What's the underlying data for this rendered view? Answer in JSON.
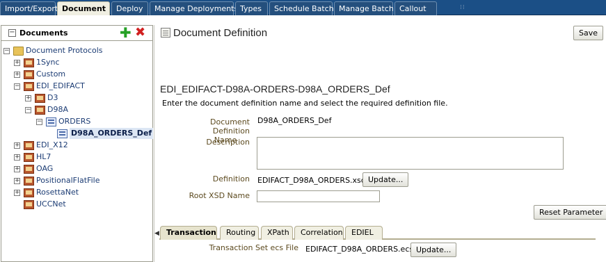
{
  "top_tabs": [
    {
      "label": "Import/Export"
    },
    {
      "label": "Document"
    },
    {
      "label": "Deploy"
    },
    {
      "label": "Manage Deployments"
    },
    {
      "label": "Types"
    },
    {
      "label": "Schedule Batch"
    },
    {
      "label": "Manage Batch"
    },
    {
      "label": "Callout"
    }
  ],
  "navigator": {
    "title": "Documents",
    "add_icon": "plus-icon",
    "delete_icon": "x-icon",
    "tree": [
      {
        "label": "Document Protocols",
        "expander": "−",
        "icon": "folder-icon"
      },
      {
        "label": "1Sync",
        "expander": "+",
        "icon": "document-protocol-icon"
      },
      {
        "label": "Custom",
        "expander": "+",
        "icon": "document-protocol-icon"
      },
      {
        "label": "EDI_EDIFACT",
        "expander": "−",
        "icon": "document-protocol-icon"
      },
      {
        "label": "D3",
        "expander": "+",
        "icon": "document-protocol-icon"
      },
      {
        "label": "D98A",
        "expander": "−",
        "icon": "document-protocol-icon"
      },
      {
        "label": "ORDERS",
        "expander": "−",
        "icon": "document-type-icon"
      },
      {
        "label": "D98A_ORDERS_Def",
        "expander": "",
        "icon": "document-definition-icon"
      },
      {
        "label": "EDI_X12",
        "expander": "+",
        "icon": "document-protocol-icon"
      },
      {
        "label": "HL7",
        "expander": "+",
        "icon": "document-protocol-icon"
      },
      {
        "label": "OAG",
        "expander": "+",
        "icon": "document-protocol-icon"
      },
      {
        "label": "PositionalFlatFile",
        "expander": "+",
        "icon": "document-protocol-icon"
      },
      {
        "label": "RosettaNet",
        "expander": "+",
        "icon": "document-protocol-icon"
      },
      {
        "label": "UCCNet",
        "expander": "",
        "icon": "document-protocol-icon"
      }
    ]
  },
  "main": {
    "title": "Document Definition",
    "save_label": "Save",
    "subheader": "EDI_EDIFACT-D98A-ORDERS-D98A_ORDERS_Def",
    "instruction": "Enter the document definition name and select the required definition file.",
    "fields": {
      "name_label_1": "Document Definition",
      "name_label_2": "Name",
      "name_value": "D98A_ORDERS_Def",
      "description_label": "Description",
      "description_value": "",
      "definition_label": "Definition",
      "definition_value": "EDIFACT_D98A_ORDERS.xsd",
      "update_label": "Update...",
      "root_xsd_label": "Root XSD Name",
      "root_xsd_value": ""
    },
    "reset_label": "Reset Parameter",
    "sub_tabs": [
      {
        "label": "Transaction"
      },
      {
        "label": "Routing"
      },
      {
        "label": "XPath"
      },
      {
        "label": "Correlation"
      },
      {
        "label": "EDIEL"
      }
    ],
    "transaction": {
      "ecs_label": "Transaction Set ecs File",
      "ecs_value": "EDIFACT_D98A_ORDERS.ecs",
      "update_label": "Update..."
    }
  }
}
